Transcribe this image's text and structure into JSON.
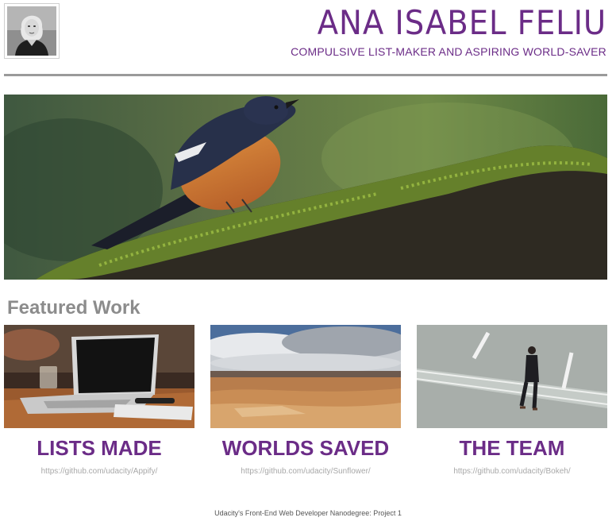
{
  "header": {
    "name": "ANA ISABEL FELIU",
    "tagline": "COMPULSIVE LIST-MAKER AND ASPIRING WORLD-SAVER"
  },
  "colors": {
    "accent": "#6b2c87",
    "divider": "#9a9a9a",
    "section_heading": "#8c8c8c",
    "link": "#a8a8a8"
  },
  "hero": {
    "image": "bird-on-mossy-branch"
  },
  "featured": {
    "heading": "Featured Work",
    "items": [
      {
        "title": "LISTS MADE",
        "link": "https://github.com/udacity/Appify/",
        "image": "laptop-on-table"
      },
      {
        "title": "WORLDS SAVED",
        "link": "https://github.com/udacity/Sunflower/",
        "image": "desert-landscape"
      },
      {
        "title": "THE TEAM",
        "link": "https://github.com/udacity/Bokeh/",
        "image": "man-crossing-road"
      }
    ]
  },
  "footer": {
    "text": "Udacity's Front-End Web Developer Nanodegree: Project 1"
  }
}
